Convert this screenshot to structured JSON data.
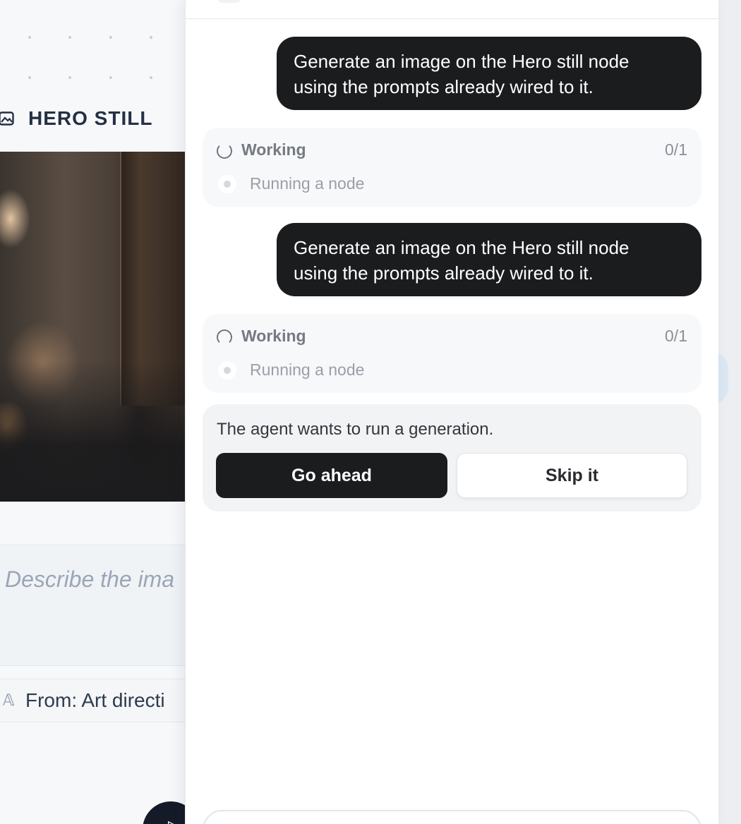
{
  "canvas": {
    "node_title": "HERO STILL",
    "node_icon": "image-icon",
    "prompt_placeholder": "Describe the ima",
    "from_label": "From: Art directi",
    "from_icon": "text-A-icon",
    "fab_icon": "send-icon"
  },
  "chat": {
    "messages": [
      {
        "role": "user",
        "lines": [
          "Generate an image on the Hero still node",
          "using the prompts already wired to it."
        ]
      },
      {
        "role": "status",
        "label": "Working",
        "count": "0/1",
        "step": "Running a node"
      },
      {
        "role": "user",
        "lines": [
          "Generate an image on the Hero still node",
          "using the prompts already wired to it."
        ]
      },
      {
        "role": "status",
        "label": "Working",
        "count": "0/1",
        "step": "Running a node"
      }
    ],
    "approval": {
      "text": "The agent wants to run a generation.",
      "confirm_label": "Go ahead",
      "skip_label": "Skip it"
    }
  },
  "colors": {
    "bubble_bg": "#1b1c1e",
    "card_bg": "#f7f8fa",
    "approval_bg": "#f1f3f5",
    "panel_bg": "#ffffff",
    "node_title": "#243044"
  }
}
